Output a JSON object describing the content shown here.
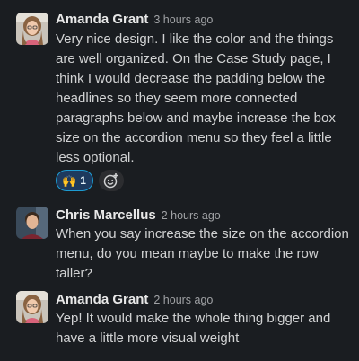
{
  "messages": [
    {
      "author": "Amanda Grant",
      "time": "3 hours ago",
      "text": "Very nice design. I like the color and the things\nare well organized. On the Case Study page, I\nthink I would decrease the padding below the\nheadlines so they seem more connected\nparagraphs below and maybe increase the box\nsize on the accordion menu so they feel a little\nless optional.",
      "reactions": [
        {
          "emoji": "🙌",
          "icon": "raised-hands-icon",
          "count": "1"
        }
      ]
    },
    {
      "author": "Chris Marcellus",
      "time": "2 hours ago",
      "text": "When you say increase the size on the accordion\nmenu, do you mean maybe to make the row\ntaller?"
    },
    {
      "author": "Amanda Grant",
      "time": "2 hours ago",
      "text": "Yep! It would make the whole thing bigger and\nhave a little more visual weight"
    }
  ],
  "colors": {
    "background": "#1a1d21",
    "reaction_bg": "#1d3a5e",
    "reaction_border": "#1d9bd1"
  }
}
